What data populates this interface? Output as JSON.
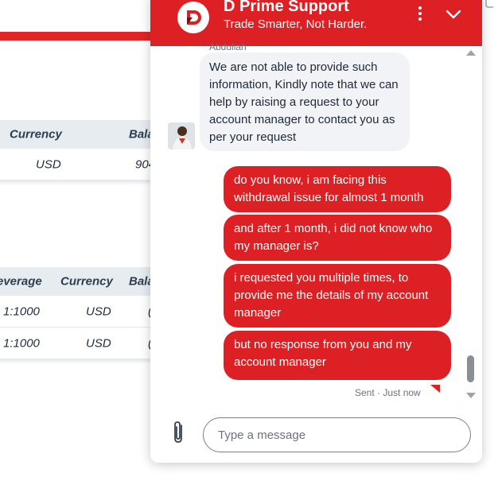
{
  "background": {
    "table1": {
      "headers": [
        "Currency",
        "Bala"
      ],
      "rows": [
        [
          "USD",
          "904"
        ]
      ]
    },
    "table2": {
      "headers": [
        "everage",
        "Currency",
        "Bala"
      ],
      "rows": [
        [
          "1:1000",
          "USD",
          "("
        ],
        [
          "1:1000",
          "USD",
          "("
        ]
      ]
    }
  },
  "chat": {
    "title": "D Prime Support",
    "subtitle": "Trade Smarter, Not Harder.",
    "sender_name": "Abdullah",
    "incoming_message": "We are not able to provide such information, Kindly note that we can help by raising a request to your account manager to contact you as per your request",
    "outgoing_messages": [
      "do you know, i am facing this withdrawal issue for almost 1 month",
      "and after 1 month, i did not know who my manager is?",
      "i requested you multiple times, to provide me the details of my account manager",
      "but no response from you and my account manager"
    ],
    "status": "Sent · Just now",
    "input_placeholder": "Type a message",
    "icons": {
      "menu": "more-vertical-icon",
      "collapse": "chevron-down-icon",
      "attach": "paperclip-icon",
      "logo": "d-prime-logo-icon"
    },
    "colors": {
      "brand": "#dc2024",
      "incoming_bubble": "#f1f3f6"
    }
  }
}
